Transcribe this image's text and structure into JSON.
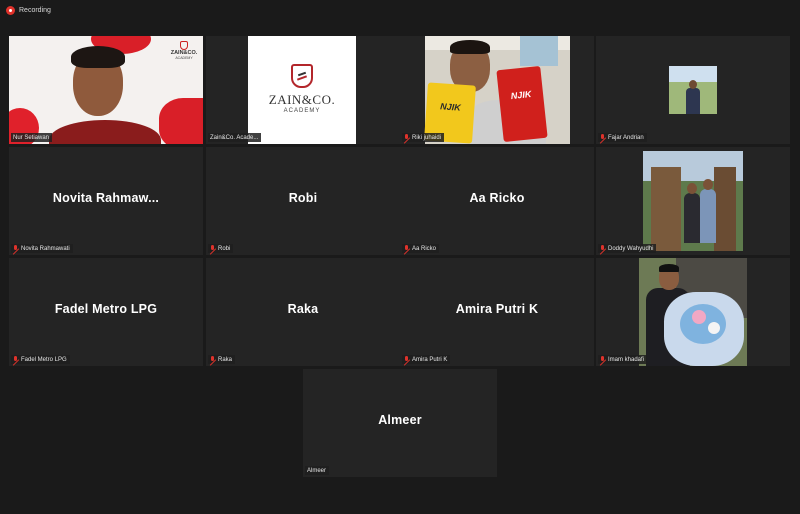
{
  "recording": {
    "label": "Recording"
  },
  "participants": [
    {
      "display_name": "",
      "tag": "Nur Setiawan"
    },
    {
      "display_name": "",
      "tag": "Zain&Co. Acade..."
    },
    {
      "display_name": "",
      "tag": "Riki juhaidi"
    },
    {
      "display_name": "",
      "tag": "Fajar Andrian"
    },
    {
      "display_name": "Novita  Rahmaw...",
      "tag": "Novita Rahmawati"
    },
    {
      "display_name": "Robi",
      "tag": "Robi"
    },
    {
      "display_name": "Aa Ricko",
      "tag": "Aa Ricko"
    },
    {
      "display_name": "",
      "tag": "Doddy Wahyudhi"
    },
    {
      "display_name": "Fadel Metro LPG",
      "tag": "Fadel Metro LPG"
    },
    {
      "display_name": "Raka",
      "tag": "Raka"
    },
    {
      "display_name": "Amira Putri K",
      "tag": "Amira Putri K"
    },
    {
      "display_name": "",
      "tag": "Imam khadafi"
    },
    {
      "display_name": "Almeer",
      "tag": "Almeer"
    }
  ],
  "logo": {
    "brand": "ZAIN&CO.",
    "sub": "ACADEMY",
    "brand_small": "ZAIN&CO.",
    "sub_small": "ACADEMY"
  },
  "snack": {
    "text1": "NJIK",
    "text2": "NJIK"
  },
  "colors": {
    "accent_active": "#d8e36a",
    "muted_red": "#e0322b",
    "tile_bg": "#242424",
    "app_bg": "#1a1a1a"
  }
}
